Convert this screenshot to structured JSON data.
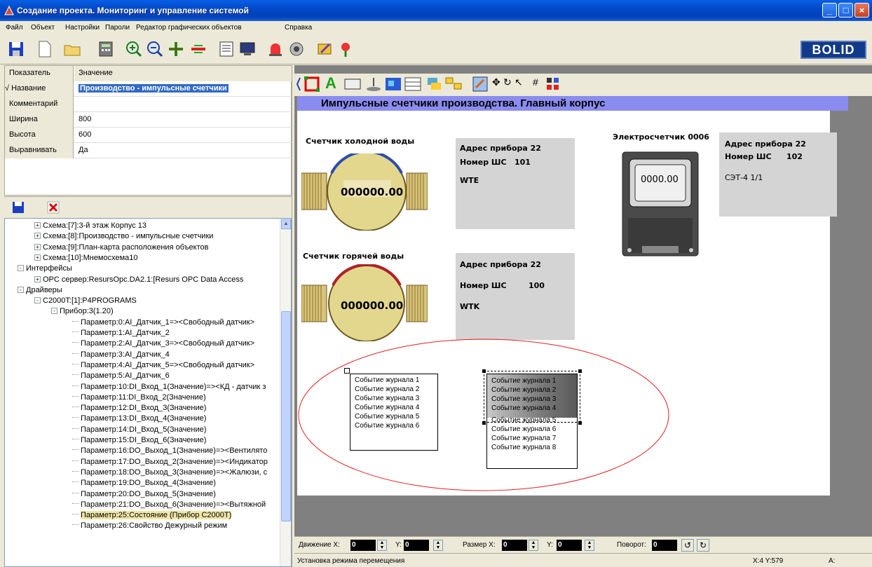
{
  "window": {
    "title": "Создание проекта. Мониторинг и управление системой"
  },
  "menu": [
    "Файл",
    "Объект",
    "Настройки",
    "Пароли",
    "Редактор графических объектов",
    "Справка"
  ],
  "logo": "BOLID",
  "props": {
    "header": {
      "key": "Показатель",
      "value": "Значение"
    },
    "rows": [
      {
        "key": "Название",
        "value": "Производство - импульсные счетчики",
        "mark": "√"
      },
      {
        "key": "Комментарий",
        "value": ""
      },
      {
        "key": "Ширина",
        "value": "800"
      },
      {
        "key": "Высота",
        "value": "600"
      },
      {
        "key": "Выравнивать",
        "value": "Да"
      }
    ]
  },
  "tree": [
    {
      "text": "Схема:[7]:3-й этаж Корпус 13",
      "exp": "+"
    },
    {
      "text": "Схема:[8]:Производство - импульсные счетчики",
      "exp": "+"
    },
    {
      "text": "Схема:[9]:План-карта расположения объектов",
      "exp": "+"
    },
    {
      "text": "Схема:[10]:Мнемосхема10",
      "exp": "+"
    },
    {
      "text": "Интерфейсы",
      "exp": "-"
    },
    {
      "text": "OPC сервер:ResursOpc.DA2.1:[Resurs OPC Data Access",
      "exp": "+"
    },
    {
      "text": "Драйверы",
      "exp": "-"
    },
    {
      "text": "C2000T:[1]:P4PROGRAMS",
      "exp": "-"
    },
    {
      "text": "Прибор:3(1.20)",
      "exp": "-"
    },
    {
      "text": "Параметр:0:AI_Датчик_1=><Свободный датчик>"
    },
    {
      "text": "Параметр:1:AI_Датчик_2"
    },
    {
      "text": "Параметр:2:AI_Датчик_3=><Свободный датчик>"
    },
    {
      "text": "Параметр:3:AI_Датчик_4"
    },
    {
      "text": "Параметр:4:AI_Датчик_5=><Свободный датчик>"
    },
    {
      "text": "Параметр:5:AI_Датчик_6"
    },
    {
      "text": "Параметр:10:DI_Вход_1(Значение)=><КД - датчик з"
    },
    {
      "text": "Параметр:11:DI_Вход_2(Значение)"
    },
    {
      "text": "Параметр:12:DI_Вход_3(Значение)"
    },
    {
      "text": "Параметр:13:DI_Вход_4(Значение)"
    },
    {
      "text": "Параметр:14:DI_Вход_5(Значение)"
    },
    {
      "text": "Параметр:15:DI_Вход_6(Значение)"
    },
    {
      "text": "Параметр:16:DO_Выход_1(Значение)=><Вентилято"
    },
    {
      "text": "Параметр:17:DO_Выход_2(Значение)=><Индикатор"
    },
    {
      "text": "Параметр:18:DO_Выход_3(Значение)=><Жалюзи, с"
    },
    {
      "text": "Параметр:19:DO_Выход_4(Значение)"
    },
    {
      "text": "Параметр:20:DO_Выход_5(Значение)"
    },
    {
      "text": "Параметр:21:DO_Выход_6(Значение)=><Вытяжной"
    },
    {
      "text": "Параметр:25:Состояние (Прибор С2000Т)",
      "selected": true
    },
    {
      "text": "Параметр:26:Свойство Дежурный режим"
    }
  ],
  "canvas": {
    "title": "Импульсные счетчики производства. Главный корпус",
    "cold": {
      "caption": "Счетчик холодной воды",
      "display": "000000.00",
      "addr": "Адрес прибора 22",
      "shs_label": "Номер ШС",
      "shs": "101",
      "tag": "WTE"
    },
    "hot": {
      "caption": "Счетчик горячей воды",
      "display": "000000.00",
      "addr": "Адрес прибора 22",
      "shs_label": "Номер ШС",
      "shs": "100",
      "tag": "WTK"
    },
    "elec": {
      "caption": "Электросчетчик 0006",
      "display": "0000.00",
      "addr": "Адрес прибора 22",
      "shs_label": "Номер ШС",
      "shs": "102",
      "tag": "СЭТ-4 1/1"
    },
    "journal1": [
      "Событие журнала 1",
      "Событие журнала 2",
      "Событие журнала 3",
      "Событие журнала 4",
      "Событие журнала 5",
      "Событие журнала 6"
    ],
    "journal2": [
      "Событие журнала 1",
      "Событие журнала 2",
      "Событие журнала 3",
      "Событие журнала 4",
      "Событие журнала 5",
      "Событие журнала 6",
      "Событие журнала 7",
      "Событие журнала 8"
    ]
  },
  "controls": {
    "move_x_label": "Движение X:",
    "move_x": "0",
    "move_y_label": "Y:",
    "move_y": "0",
    "size_x_label": "Размер X:",
    "size_x": "0",
    "size_y_label": "Y:",
    "size_y": "0",
    "rotate_label": "Поворот:",
    "rotate": "0"
  },
  "status": {
    "mode": "Установка режима перемещения",
    "coords": "X:4 Y:579",
    "extra": "A:"
  }
}
